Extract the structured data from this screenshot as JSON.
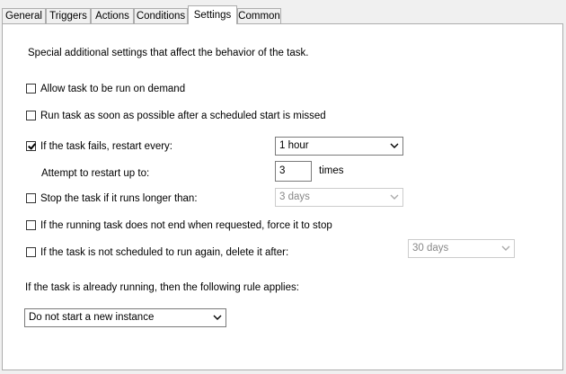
{
  "tabs": [
    {
      "label": "General"
    },
    {
      "label": "Triggers"
    },
    {
      "label": "Actions"
    },
    {
      "label": "Conditions"
    },
    {
      "label": "Settings",
      "active": true
    },
    {
      "label": "Common"
    }
  ],
  "settings": {
    "intro": "Special additional settings that affect the behavior of the task.",
    "allow_on_demand": {
      "label": "Allow task to be run on demand",
      "checked": false
    },
    "run_asap": {
      "label": "Run task as soon as possible after a scheduled start is missed",
      "checked": false
    },
    "restart_on_fail": {
      "label": "If the task fails, restart every:",
      "checked": true,
      "interval": "1 hour"
    },
    "restart_attempts": {
      "label": "Attempt to restart up to:",
      "value": "3",
      "unit": "times"
    },
    "stop_if_longer": {
      "label": "Stop the task if it runs longer than:",
      "checked": false,
      "duration": "3 days"
    },
    "force_stop": {
      "label": "If the running task does not end when requested, force it to stop",
      "checked": false
    },
    "delete_after": {
      "label": "If the task is not scheduled to run again, delete it after:",
      "checked": false,
      "duration": "30 days"
    },
    "rule_label": "If the task is already running, then the following rule applies:",
    "rule_value": "Do not start a new instance"
  },
  "icons": [
    "checkmark-icon",
    "dropdown-arrow-icon"
  ],
  "colors": {
    "border": "#adadad",
    "disabled_text": "#888888",
    "panel_bg": "#ffffff",
    "window_bg": "#f0f0f0"
  }
}
